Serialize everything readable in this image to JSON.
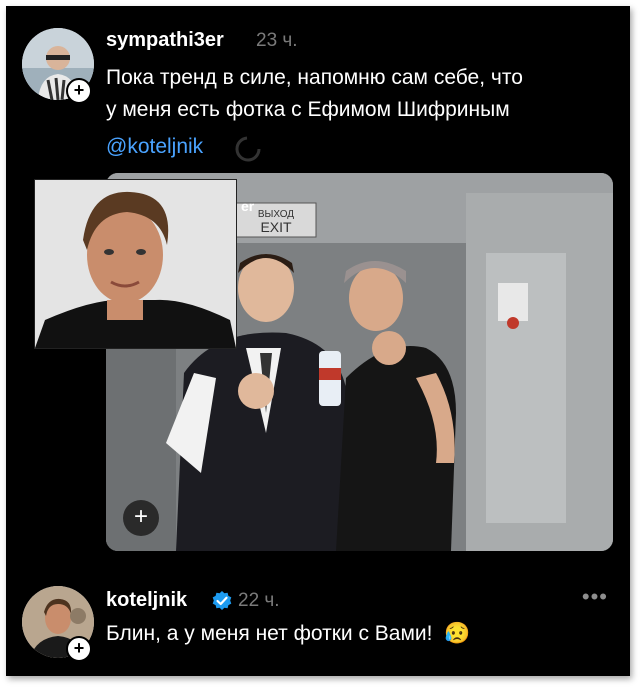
{
  "post": {
    "username": "sympathi3er",
    "time": "23 ч.",
    "text_line1": "Пока тренд в силе, напомню сам себе, что",
    "text_line2": "у меня есть фотка с Ефимом Шифриным",
    "mention": "@koteljnik",
    "photo_sign_exit_ru": "ВЫХОД",
    "photo_sign_exit_en": "EXIT",
    "photo_partial_text": "er"
  },
  "reply": {
    "username": "koteljnik",
    "time": "22 ч.",
    "text": "Блин, а у меня нет фотки с Вами!",
    "emoji": "😥",
    "more": "•••"
  },
  "icons": {
    "follow_plus": "plus-icon",
    "verified": "verified-badge-icon",
    "more": "more-options-icon"
  },
  "colors": {
    "background": "#000000",
    "text": "#ffffff",
    "muted": "#7a7a7a",
    "link": "#4aa3ff",
    "verified": "#1d9bf0"
  }
}
